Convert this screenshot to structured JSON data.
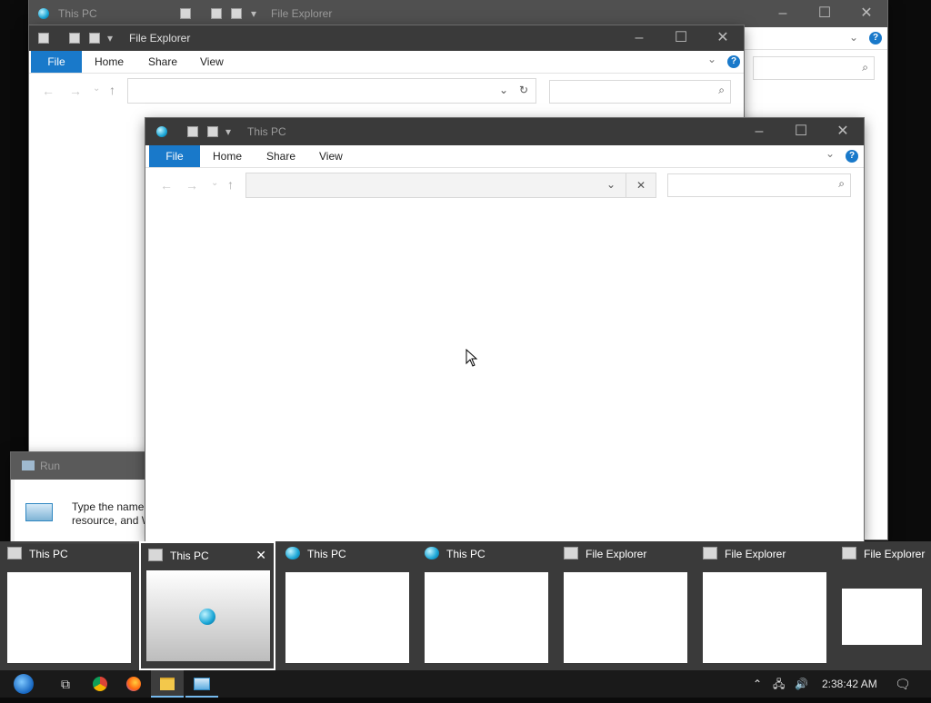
{
  "window_back": {
    "title": "This PC",
    "quick_access_title": "File Explorer"
  },
  "window_middle": {
    "title": "File Explorer",
    "tabs": [
      "File",
      "Home",
      "Share",
      "View"
    ]
  },
  "window_front": {
    "title": "This PC",
    "tabs": [
      "File",
      "Home",
      "Share",
      "View"
    ]
  },
  "run_dialog": {
    "title": "Run",
    "desc_line1": "Type the name",
    "desc_line2": "resource, and W"
  },
  "alt_tab": {
    "items": [
      {
        "label": "This PC",
        "icon": "explorer-window-icon"
      },
      {
        "label": "This PC",
        "icon": "explorer-window-icon",
        "selected": true
      },
      {
        "label": "This PC",
        "icon": "globe-icon"
      },
      {
        "label": "This PC",
        "icon": "globe-icon"
      },
      {
        "label": "File Explorer",
        "icon": "explorer-window-icon"
      },
      {
        "label": "File Explorer",
        "icon": "explorer-window-icon"
      },
      {
        "label": "File Explorer",
        "icon": "explorer-window-icon"
      }
    ]
  },
  "taskbar": {
    "apps": [
      "start-icon",
      "task-view-icon",
      "chrome-icon",
      "firefox-icon",
      "file-explorer-icon",
      "run-icon"
    ],
    "clock": "2:38:42 AM"
  },
  "colors": {
    "accent": "#1979ca",
    "titlebar": "#3a3a3a",
    "taskbar": "#1a1a1a"
  }
}
